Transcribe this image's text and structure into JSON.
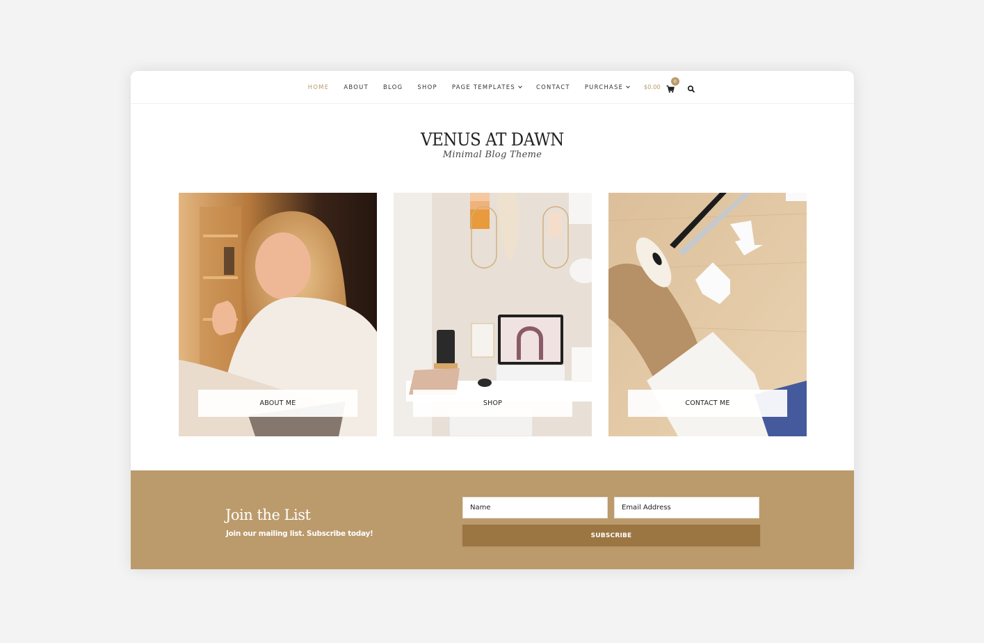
{
  "nav": {
    "items": [
      {
        "label": "HOME",
        "active": true,
        "dropdown": false
      },
      {
        "label": "ABOUT",
        "active": false,
        "dropdown": false
      },
      {
        "label": "BLOG",
        "active": false,
        "dropdown": false
      },
      {
        "label": "SHOP",
        "active": false,
        "dropdown": false
      },
      {
        "label": "PAGE TEMPLATES",
        "active": false,
        "dropdown": true
      },
      {
        "label": "CONTACT",
        "active": false,
        "dropdown": false
      },
      {
        "label": "PURCHASE",
        "active": false,
        "dropdown": true
      }
    ],
    "cart_total": "$0.00",
    "cart_count": "0",
    "cart_icon": "shopping-cart-icon",
    "search_icon": "search-icon"
  },
  "logo": {
    "title": "VENUS AT DAWN",
    "tagline": "Minimal Blog Theme"
  },
  "cards": [
    {
      "label": "ABOUT ME",
      "image": "woman-with-glasses-at-laptop"
    },
    {
      "label": "SHOP",
      "image": "desk-with-tablet-and-wall-decor"
    },
    {
      "label": "CONTACT ME",
      "image": "burlap-ribbon-pens-envelopes"
    }
  ],
  "subscribe": {
    "title": "Join the List",
    "subtitle": "Join our mailing list. Subscribe today!",
    "name_placeholder": "Name",
    "email_placeholder": "Email Address",
    "button_label": "SUBSCRIBE"
  },
  "colors": {
    "accent": "#bb9a6b",
    "button": "#9b7542",
    "background": "#f3f3f3"
  }
}
